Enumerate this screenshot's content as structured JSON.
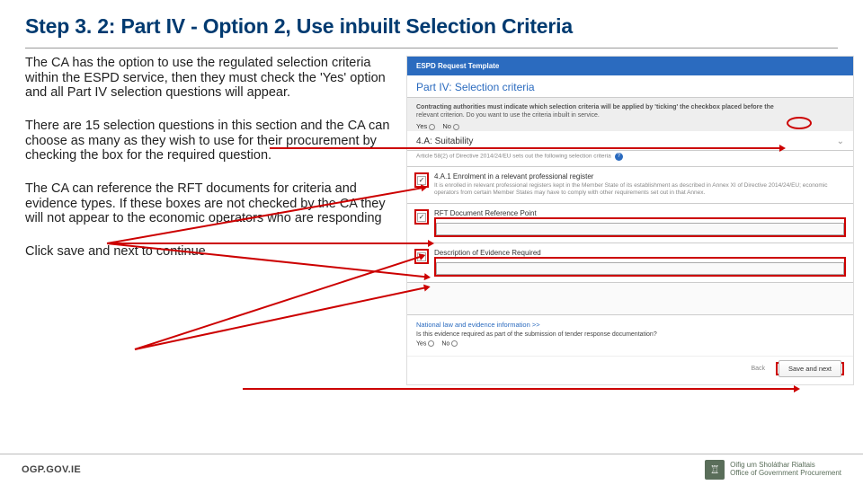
{
  "title": "Step 3. 2: Part IV  - Option 2, Use inbuilt Selection Criteria",
  "paragraphs": {
    "p1": "The CA has the option to use the regulated  selection criteria within the ESPD service, then they must check  the 'Yes' option and all Part IV selection questions will appear.",
    "p2": "There are 15 selection questions in this section and the CA can choose as many as they wish to use for their procurement by checking the box for the required question.",
    "p3": "The CA can reference the RFT documents for criteria and evidence types. If these boxes are not checked by the CA they will not appear to the economic operators who are responding",
    "p4": "Click save and next to continue"
  },
  "espd": {
    "banner": "ESPD Request Template",
    "part_header": "Part IV: Selection criteria",
    "instr_bold_prefix": "Contracting authorities must indicate which selection criteria will be applied by 'ticking' the checkbox placed before the",
    "instr_cut": "relevant criterion. Do you want to use the criteria inbuilt in service.",
    "yes": "Yes",
    "no": "No",
    "sec_4a": "4.A: Suitability",
    "sec_4a_sub": "Article 58(2) of Directive 2014/24/EU sets out the following selection criteria",
    "q1_title": "4.A.1 Enrolment in a relevant professional register",
    "q1_desc": "It is enrolled in relevant professional registers kept in the Member State of its establishment as described in Annex XI of Directive 2014/24/EU; economic operators from certain Member States may have to comply with other requirements set out in that Annex.",
    "q2_title": "RFT Document Reference Point",
    "q3_title": "Description of Evidence Required",
    "law_link": "National law and evidence information >>",
    "law_q": "Is this evidence required as part of the submission of tender response documentation?",
    "back": "Back",
    "save": "Save and next"
  },
  "footer": {
    "site": "OGP.GOV.IE",
    "logo_line1": "Oifig um Sholáthar Rialtais",
    "logo_line2": "Office of Government Procurement"
  }
}
